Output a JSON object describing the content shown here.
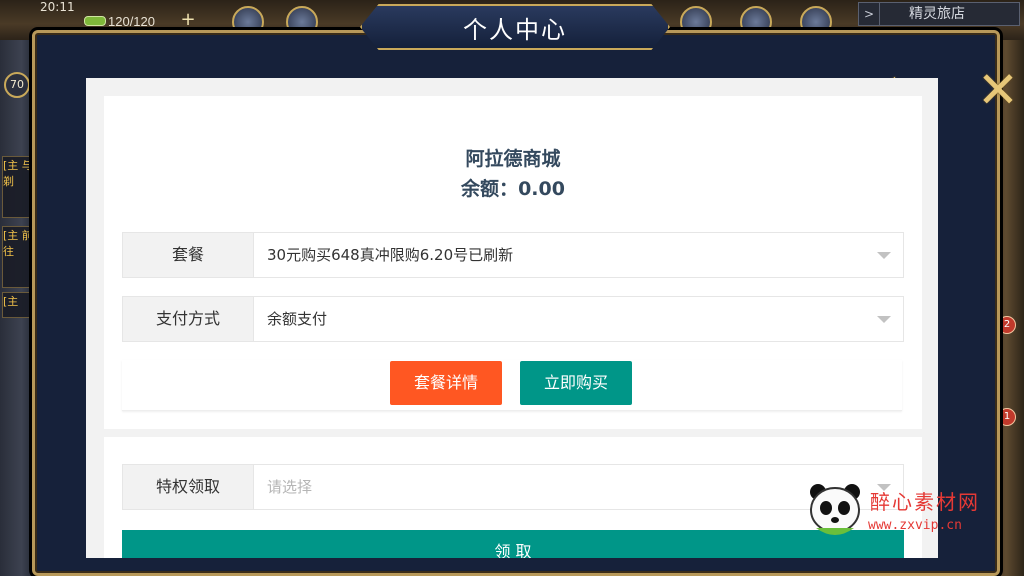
{
  "status_bar": {
    "time": "20:11",
    "energy": "120/120",
    "level": "70"
  },
  "hud": {
    "inn_label": "精灵旅店",
    "notifications": [
      "2",
      "1"
    ]
  },
  "side_tasks": [
    "[主\n与剃",
    "[主\n前往",
    "[主"
  ],
  "modal": {
    "title": "个人中心"
  },
  "shop": {
    "title": "阿拉德商城",
    "balance_label": "余额：",
    "balance_value": "0.00"
  },
  "form": {
    "package": {
      "label": "套餐",
      "value": "30元购买648真冲限购6.20号已刷新"
    },
    "payment": {
      "label": "支付方式",
      "value": "余额支付"
    },
    "details_button": "套餐详情",
    "buy_button": "立即购买",
    "privilege": {
      "label": "特权领取",
      "placeholder": "请选择"
    },
    "claim_button": "领 取"
  },
  "watermark": {
    "text": "醉心素材网",
    "url": "www.zxvip.cn"
  },
  "colors": {
    "orange": "#ff5722",
    "teal": "#009688",
    "navy_text": "#34495e",
    "frame_gold": "#b8995a",
    "watermark_red": "#e53935"
  }
}
